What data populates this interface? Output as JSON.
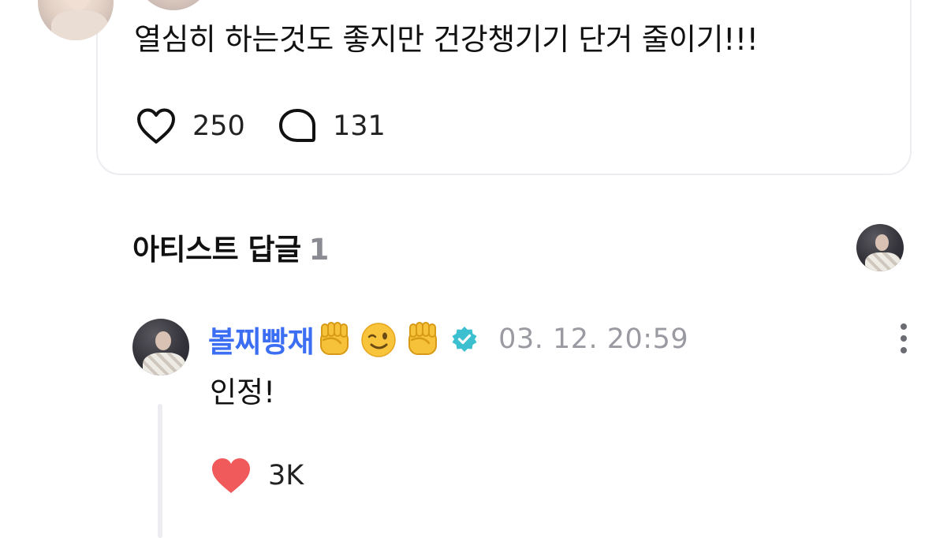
{
  "post": {
    "text": "열심히 하는것도 좋지만 건강챙기기 단거 줄이기!!!",
    "likes": "250",
    "comments": "131"
  },
  "artist_replies": {
    "title": "아티스트 답글",
    "count": "1"
  },
  "reply": {
    "username": "볼찌빵재",
    "emojis": [
      "fist-emoji",
      "winking-face-emoji",
      "fist-emoji"
    ],
    "verified": true,
    "timestamp": "03. 12. 20:59",
    "text": "인정!",
    "likes": "3K"
  },
  "colors": {
    "username": "#3b6ef2",
    "verified": "#3cc0d0",
    "like_filled": "#f05a5a",
    "timestamp": "#9a9aa2",
    "card_border": "#ececf1"
  }
}
